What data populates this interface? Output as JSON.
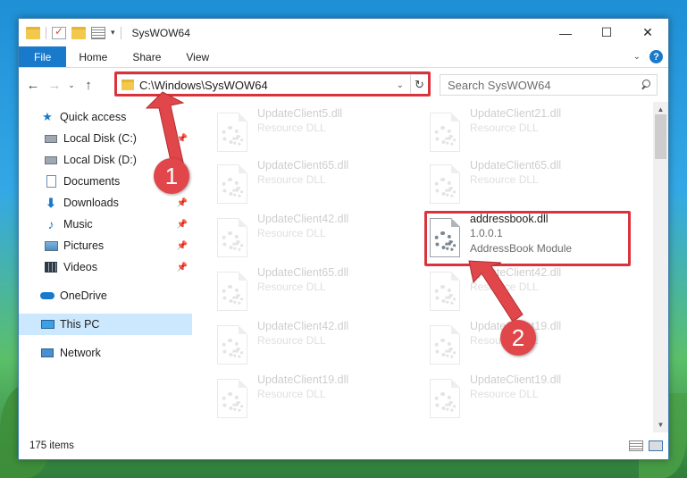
{
  "window": {
    "title": "SysWOW64",
    "minimize_label": "—",
    "maximize_label": "☐",
    "close_label": "✕"
  },
  "ribbon": {
    "tabs": [
      "File",
      "Home",
      "Share",
      "View"
    ],
    "help_label": "?"
  },
  "address": {
    "path": "C:\\Windows\\SysWOW64",
    "refresh_label": "↻"
  },
  "search": {
    "placeholder": "Search SysWOW64"
  },
  "sidebar": {
    "items": [
      {
        "label": "Quick access",
        "icon": "star-icon"
      },
      {
        "label": "Local Disk (C:)",
        "icon": "drive-icon",
        "pinned": true
      },
      {
        "label": "Local Disk (D:)",
        "icon": "drive-icon",
        "pinned": true
      },
      {
        "label": "Documents",
        "icon": "documents-icon",
        "pinned": true
      },
      {
        "label": "Downloads",
        "icon": "downloads-icon",
        "pinned": true
      },
      {
        "label": "Music",
        "icon": "music-icon",
        "pinned": true
      },
      {
        "label": "Pictures",
        "icon": "pictures-icon",
        "pinned": true
      },
      {
        "label": "Videos",
        "icon": "videos-icon",
        "pinned": true
      },
      {
        "label": "OneDrive",
        "icon": "cloud-icon"
      },
      {
        "label": "This PC",
        "icon": "pc-icon",
        "selected": true
      },
      {
        "label": "Network",
        "icon": "network-icon"
      }
    ]
  },
  "files": {
    "left_column": [
      {
        "name": "UpdateClient5.dll",
        "type": "Resource DLL"
      },
      {
        "name": "UpdateClient65.dll",
        "type": "Resource DLL"
      },
      {
        "name": "UpdateClient42.dll",
        "type": "Resource DLL"
      },
      {
        "name": "UpdateClient65.dll",
        "type": "Resource DLL"
      },
      {
        "name": "UpdateClient42.dll",
        "type": "Resource DLL"
      },
      {
        "name": "UpdateClient19.dll",
        "type": "Resource DLL"
      }
    ],
    "right_column": [
      {
        "name": "UpdateClient21.dll",
        "type": "Resource DLL"
      },
      {
        "name": "UpdateClient65.dll",
        "type": "Resource DLL"
      },
      {
        "name": "UpdateClient42.dll",
        "type": "Resource DLL"
      },
      {
        "name": "UpdateClient19.dll",
        "type": "Resource DLL"
      },
      {
        "name": "UpdateClient19.dll",
        "type": "Resource DLL"
      }
    ],
    "highlighted": {
      "name": "addressbook.dll",
      "version": "1.0.0.1",
      "description": "AddressBook Module"
    }
  },
  "status": {
    "item_count": "175 items"
  },
  "annotations": {
    "badge_1": "1",
    "badge_2": "2",
    "color": "#e0464a"
  }
}
